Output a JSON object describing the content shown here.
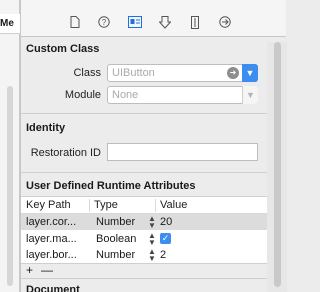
{
  "left_panel": {
    "tab_label": "Me"
  },
  "inspector_tabs": [
    {
      "name": "file-icon",
      "glyph": "▯"
    },
    {
      "name": "help-icon",
      "glyph": "?"
    },
    {
      "name": "identity-icon",
      "glyph": "▣",
      "selected": true
    },
    {
      "name": "attributes-icon",
      "glyph": "⇩"
    },
    {
      "name": "size-icon",
      "glyph": "▮"
    },
    {
      "name": "connections-icon",
      "glyph": "→"
    }
  ],
  "custom_class": {
    "title": "Custom Class",
    "class_label": "Class",
    "class_placeholder": "UIButton",
    "module_label": "Module",
    "module_placeholder": "None"
  },
  "identity": {
    "title": "Identity",
    "restoration_id_label": "Restoration ID",
    "restoration_id_value": ""
  },
  "runtime_attributes": {
    "title": "User Defined Runtime Attributes",
    "columns": [
      "Key Path",
      "Type",
      "Value"
    ],
    "rows": [
      {
        "key_path": "layer.cor...",
        "type": "Number",
        "value": "20",
        "selected": true
      },
      {
        "key_path": "layer.ma...",
        "type": "Boolean",
        "value": "✓",
        "is_bool": true,
        "checked": true
      },
      {
        "key_path": "layer.bor...",
        "type": "Number",
        "value": "2"
      }
    ],
    "add_label": "+",
    "remove_label": "—"
  },
  "document": {
    "title": "Document"
  },
  "colors": {
    "accent": "#3b8ef0",
    "panel_bg": "#ececec",
    "selected_row": "#dcdcdc"
  }
}
